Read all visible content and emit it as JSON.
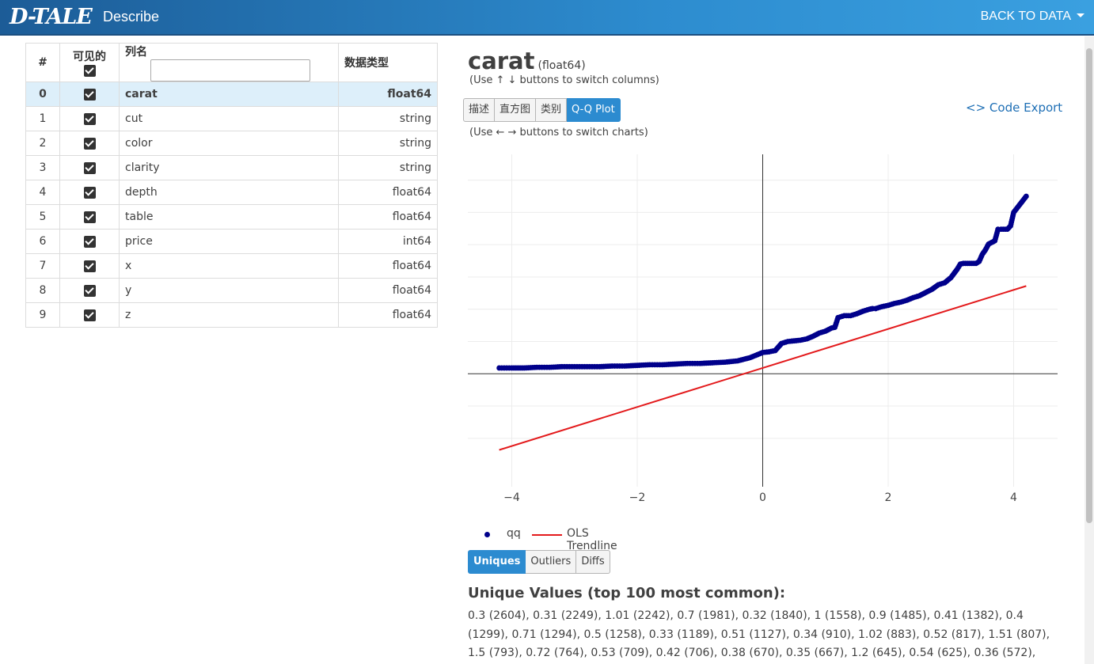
{
  "header": {
    "logo": "D-TALE",
    "page_name": "Describe",
    "back_label": "BACK TO DATA"
  },
  "columns_table": {
    "headers": {
      "index": "#",
      "visible": "可见的",
      "name": "列名",
      "dtype": "数据类型"
    },
    "search_value": "",
    "rows": [
      {
        "index": "0",
        "name": "carat",
        "dtype": "float64"
      },
      {
        "index": "1",
        "name": "cut",
        "dtype": "string"
      },
      {
        "index": "2",
        "name": "color",
        "dtype": "string"
      },
      {
        "index": "3",
        "name": "clarity",
        "dtype": "string"
      },
      {
        "index": "4",
        "name": "depth",
        "dtype": "float64"
      },
      {
        "index": "5",
        "name": "table",
        "dtype": "float64"
      },
      {
        "index": "6",
        "name": "price",
        "dtype": "int64"
      },
      {
        "index": "7",
        "name": "x",
        "dtype": "float64"
      },
      {
        "index": "8",
        "name": "y",
        "dtype": "float64"
      },
      {
        "index": "9",
        "name": "z",
        "dtype": "float64"
      }
    ],
    "selected_index": 0
  },
  "details": {
    "column_name": "carat",
    "column_dtype": "(float64)",
    "switch_columns_hint": "(Use ↑ ↓ buttons to switch columns)",
    "switch_charts_hint": "(Use ← → buttons to switch charts)",
    "chart_tabs": [
      "描述",
      "直方图",
      "类别",
      "Q-Q Plot"
    ],
    "active_chart_tab": "Q-Q Plot",
    "code_export": "Code Export",
    "detail_tabs": [
      "Uniques",
      "Outliers",
      "Diffs"
    ],
    "active_detail_tab": "Uniques",
    "uniques_title": "Unique Values (top 100 most common):",
    "uniques_text": "0.3 (2604), 0.31 (2249), 1.01 (2242), 0.7 (1981), 0.32 (1840), 1 (1558), 0.9 (1485), 0.41 (1382), 0.4 (1299), 0.71 (1294), 0.5 (1258), 0.33 (1189), 0.51 (1127), 0.34 (910), 1.02 (883), 0.52 (817), 1.51 (807), 1.5 (793), 0.72 (764), 0.53 (709), 0.42 (706), 0.38 (670), 0.35 (667), 1.2 (645), 0.54 (625), 0.36 (572),"
  },
  "chart_data": {
    "type": "scatter",
    "xlim": [
      -4.7,
      4.7
    ],
    "ylim": [
      -1.75,
      3.4
    ],
    "x_ticks": [
      -4,
      -2,
      0,
      2,
      4
    ],
    "x_tick_labels": [
      "−4",
      "−2",
      "0",
      "2",
      "4"
    ],
    "y_gridlines": [
      -1,
      -0.5,
      0.5,
      1,
      1.5,
      2,
      2.5,
      3
    ],
    "grid": true,
    "legend_position": "bottom-left",
    "series": [
      {
        "name": "qq",
        "kind": "markers",
        "color": "#00008b",
        "points": [
          [
            -4.2,
            0.09
          ],
          [
            -4.0,
            0.09
          ],
          [
            -3.9,
            0.09
          ],
          [
            -3.8,
            0.09
          ],
          [
            -3.6,
            0.1
          ],
          [
            -3.4,
            0.1
          ],
          [
            -3.2,
            0.11
          ],
          [
            -3.0,
            0.11
          ],
          [
            -2.8,
            0.11
          ],
          [
            -2.6,
            0.11
          ],
          [
            -2.4,
            0.12
          ],
          [
            -2.2,
            0.12
          ],
          [
            -2.0,
            0.13
          ],
          [
            -1.8,
            0.14
          ],
          [
            -1.6,
            0.14
          ],
          [
            -1.4,
            0.15
          ],
          [
            -1.2,
            0.16
          ],
          [
            -1.0,
            0.16
          ],
          [
            -0.8,
            0.17
          ],
          [
            -0.6,
            0.18
          ],
          [
            -0.4,
            0.2
          ],
          [
            -0.2,
            0.25
          ],
          [
            0.0,
            0.33
          ],
          [
            0.1,
            0.34
          ],
          [
            0.2,
            0.36
          ],
          [
            0.3,
            0.47
          ],
          [
            0.4,
            0.5
          ],
          [
            0.5,
            0.51
          ],
          [
            0.6,
            0.52
          ],
          [
            0.7,
            0.54
          ],
          [
            0.8,
            0.58
          ],
          [
            0.9,
            0.63
          ],
          [
            1.0,
            0.66
          ],
          [
            1.1,
            0.71
          ],
          [
            1.15,
            0.72
          ],
          [
            1.2,
            0.87
          ],
          [
            1.3,
            0.9
          ],
          [
            1.4,
            0.9
          ],
          [
            1.5,
            0.93
          ],
          [
            1.6,
            0.97
          ],
          [
            1.7,
            1.0
          ],
          [
            1.75,
            1.01
          ],
          [
            1.8,
            1.01
          ],
          [
            1.9,
            1.04
          ],
          [
            2.0,
            1.06
          ],
          [
            2.1,
            1.09
          ],
          [
            2.2,
            1.11
          ],
          [
            2.3,
            1.14
          ],
          [
            2.4,
            1.18
          ],
          [
            2.5,
            1.21
          ],
          [
            2.6,
            1.26
          ],
          [
            2.7,
            1.31
          ],
          [
            2.8,
            1.38
          ],
          [
            2.9,
            1.41
          ],
          [
            3.0,
            1.49
          ],
          [
            3.1,
            1.62
          ],
          [
            3.15,
            1.7
          ],
          [
            3.2,
            1.71
          ],
          [
            3.3,
            1.71
          ],
          [
            3.4,
            1.71
          ],
          [
            3.45,
            1.74
          ],
          [
            3.5,
            1.85
          ],
          [
            3.55,
            1.92
          ],
          [
            3.6,
            2.01
          ],
          [
            3.7,
            2.06
          ],
          [
            3.75,
            2.24
          ],
          [
            3.8,
            2.24
          ],
          [
            3.9,
            2.24
          ],
          [
            3.95,
            2.29
          ],
          [
            4.0,
            2.5
          ],
          [
            4.2,
            2.75
          ]
        ]
      },
      {
        "name": "OLS Trendline",
        "kind": "line",
        "color": "#e31a1c",
        "points": [
          [
            -4.2,
            -1.18
          ],
          [
            4.2,
            1.36
          ]
        ]
      }
    ]
  }
}
